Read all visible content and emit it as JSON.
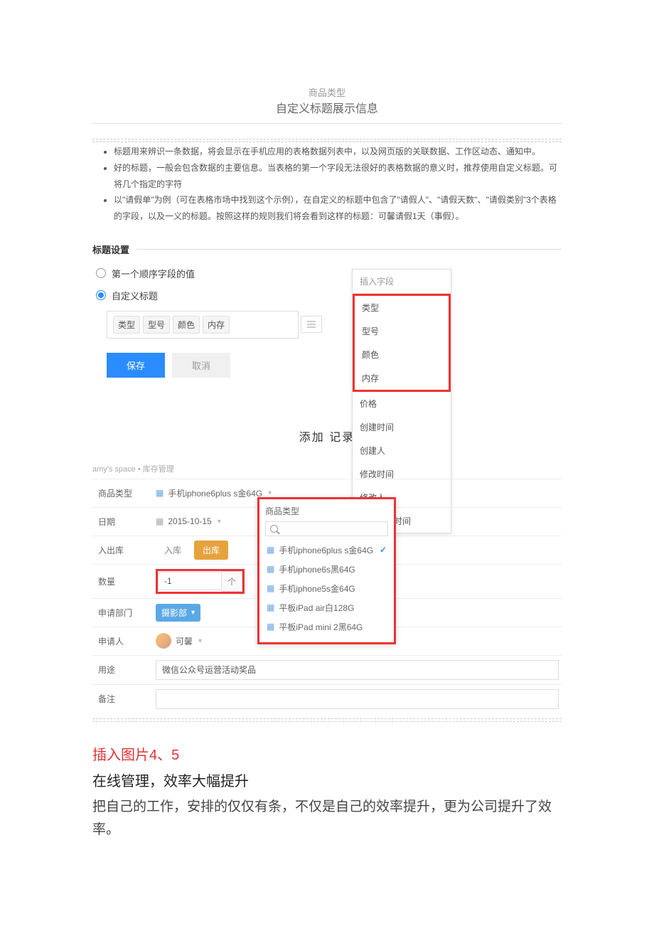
{
  "header": {
    "small": "商品类型",
    "main": "自定义标题展示信息"
  },
  "bullets": [
    "标题用来辨识一条数据，将会显示在手机应用的表格数据列表中，以及网页版的关联数据、工作区动态、通知中。",
    "好的标题，一般会包含数据的主要信息。当表格的第一个字段无法很好的表格数据的意义时，推荐使用自定义标题。可将几个指定的字符",
    "以\"请假单\"为例（可在表格市场中找到这个示例），在自定义的标题中包含了\"请假人\"、\"请假天数\"、\"请假类别\"3个表格的字段，以及一义的标题。按照这样的规则我们将会看到这样的标题：可馨请假1天（事假）。"
  ],
  "titleSettings": {
    "section": "标题设置",
    "radio1": "第一个顺序字段的值",
    "radio2": "自定义标题",
    "tags": [
      "类型",
      "型号",
      "颜色",
      "内存"
    ],
    "save": "保存",
    "cancel": "取消"
  },
  "fieldDropdown": {
    "header": "插入字段",
    "highlighted": [
      "类型",
      "型号",
      "颜色",
      "内存"
    ],
    "rest": [
      "价格",
      "创建时间",
      "创建人",
      "修改时间",
      "修改人",
      "最后活动时间"
    ]
  },
  "section2": {
    "title": "添加 记录",
    "breadcrumb1": "amy's space",
    "breadcrumbSep": " • ",
    "breadcrumb2": "库存管理",
    "rows": {
      "productTypeLabel": "商品类型",
      "productTypeValue": "手机iphone6plus s金64G",
      "dateLabel": "日期",
      "dateValue": "2015-10-15",
      "ioLabel": "入出库",
      "ioIn": "入库",
      "ioOut": "出库",
      "qtyLabel": "数量",
      "qtyValue": "-1",
      "qtyUnit": "个",
      "deptLabel": "申请部门",
      "deptValue": "摄影部",
      "personLabel": "申请人",
      "personValue": "可馨",
      "useLabel": "用途",
      "useValue": "微信公众号运营活动奖品",
      "noteLabel": "备注"
    },
    "overlay": {
      "title": "商品类型",
      "items": [
        {
          "text": "手机iphone6plus s金64G",
          "checked": true
        },
        {
          "text": "手机iphone6s黑64G",
          "checked": false
        },
        {
          "text": "手机iphone5s金64G",
          "checked": false
        },
        {
          "text": "平板iPad air白128G",
          "checked": false
        },
        {
          "text": "平板iPad mini 2黑64G",
          "checked": false
        }
      ]
    }
  },
  "bodyText": {
    "red": "插入图片4、5",
    "bold": "在线管理，效率大幅提升",
    "para": "把自己的工作，安排的仅仅有条，不仅是自己的效率提升，更为公司提升了效率。"
  }
}
